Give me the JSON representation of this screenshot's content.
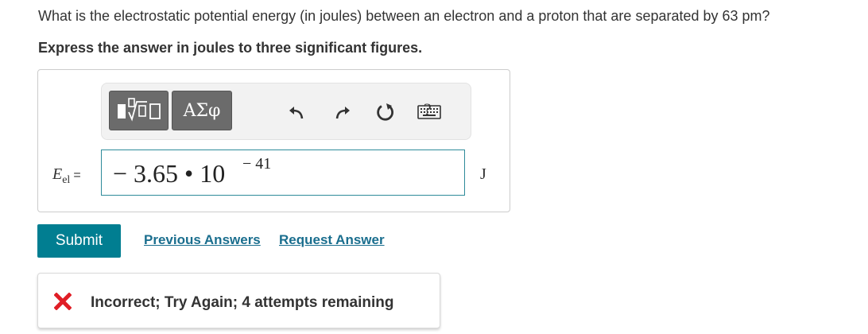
{
  "question": {
    "text": "What is the electrostatic potential energy (in joules) between an electron and a proton that are separated by 63 pm?",
    "instruction": "Express the answer in joules to three significant figures."
  },
  "toolbar": {
    "templates_icon": "templates-icon",
    "symbols_label": "ΑΣφ",
    "undo_icon": "undo-icon",
    "redo_icon": "redo-icon",
    "reset_icon": "reset-icon",
    "keyboard_icon": "keyboard-icon",
    "help_label": "?"
  },
  "equation": {
    "variable": "E",
    "subscript": "el",
    "equals": "=",
    "answer_mantissa": "− 3.65 • 10",
    "answer_exponent": "− 41",
    "unit": "J"
  },
  "actions": {
    "submit_label": "Submit",
    "previous_answers_label": "Previous Answers",
    "request_answer_label": "Request Answer"
  },
  "feedback": {
    "icon": "x-mark-icon",
    "text": "Incorrect; Try Again; 4 attempts remaining",
    "icon_color": "#e01e26"
  },
  "colors": {
    "accent": "#017e91",
    "link": "#1a6e8e",
    "input_border": "#2e8b9a"
  }
}
